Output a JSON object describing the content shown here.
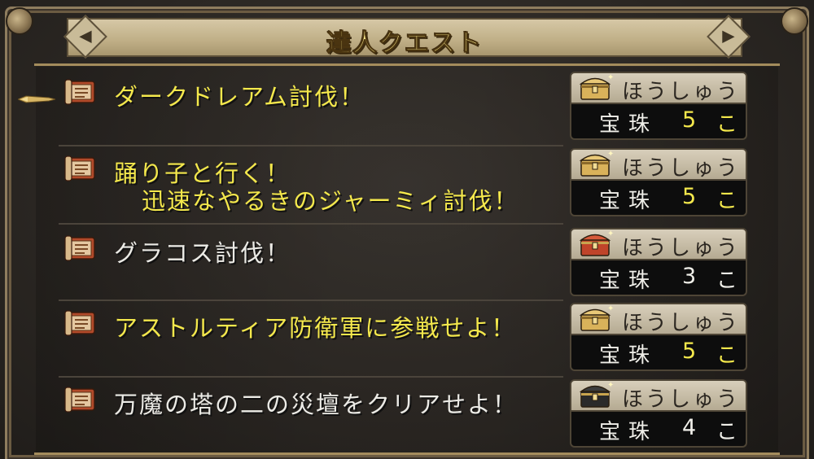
{
  "window": {
    "title": "達人クエスト"
  },
  "reward_header": "ほうしゅう",
  "quests": [
    {
      "title_lines": [
        "ダークドレアム討伐！"
      ],
      "color": "yellow",
      "reward_item": "宝珠",
      "reward_count": "5",
      "reward_unit": "こ",
      "count_color": "yellow",
      "chest": "gold-chest-icon"
    },
    {
      "title_lines": [
        "踊り子と行く！",
        "迅速なやるきのジャーミィ討伐！"
      ],
      "color": "yellow",
      "reward_item": "宝珠",
      "reward_count": "5",
      "reward_unit": "こ",
      "count_color": "yellow",
      "chest": "gold-chest-icon"
    },
    {
      "title_lines": [
        "グラコス討伐！"
      ],
      "color": "white",
      "reward_item": "宝珠",
      "reward_count": "3",
      "reward_unit": "こ",
      "count_color": "white",
      "chest": "red-chest-icon"
    },
    {
      "title_lines": [
        "アストルティア防衛軍に参戦せよ！"
      ],
      "color": "yellow",
      "reward_item": "宝珠",
      "reward_count": "5",
      "reward_unit": "こ",
      "count_color": "yellow",
      "chest": "gold-chest-icon"
    },
    {
      "title_lines": [
        "万魔の塔の二の災壇をクリアせよ！"
      ],
      "color": "white",
      "reward_item": "宝珠",
      "reward_count": "4",
      "reward_unit": "こ",
      "count_color": "white",
      "chest": "black-chest-icon"
    }
  ],
  "colors": {
    "yellow_text": "#f4e84c",
    "white_text": "#ecebe6",
    "frame_gold": "#a48c5c",
    "panel_bg": "#2b2723",
    "gold_chest": "#d9b25a",
    "red_chest": "#c0442a",
    "black_chest": "#2a2a2a"
  }
}
